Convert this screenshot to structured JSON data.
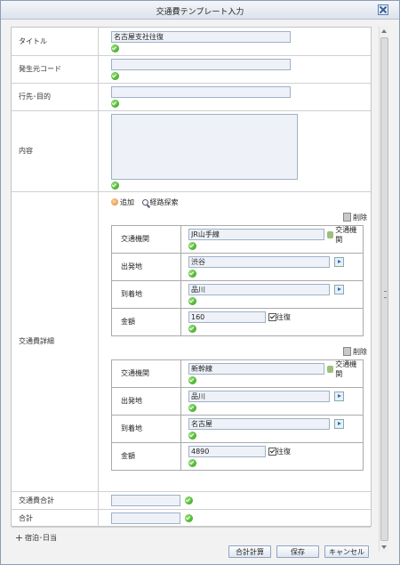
{
  "dialog": {
    "title": "交通費テンプレート入力"
  },
  "form": {
    "title_label": "タイトル",
    "title_value": "名古屋支社往復",
    "source_code_label": "発生元コード",
    "source_code_value": "",
    "destination_label": "行先･目的",
    "destination_value": "",
    "content_label": "内容",
    "content_value": "",
    "details_label": "交通費詳細",
    "add_label": "追加",
    "route_search_label": "経路探索",
    "legs": [
      {
        "delete_label": "削除",
        "transport_label": "交通機関",
        "transport_value": "JR山手線",
        "transport_link": "交通機関",
        "from_label": "出発地",
        "from_value": "渋谷",
        "to_label": "到着地",
        "to_value": "品川",
        "amount_label": "金額",
        "amount_value": "160",
        "round_trip_label": "往復",
        "round_trip_checked": true
      },
      {
        "delete_label": "削除",
        "transport_label": "交通機関",
        "transport_value": "新幹線",
        "transport_link": "交通機関",
        "from_label": "出発地",
        "from_value": "品川",
        "to_label": "到着地",
        "to_value": "名古屋",
        "amount_label": "金額",
        "amount_value": "4890",
        "round_trip_label": "往復",
        "round_trip_checked": true
      }
    ],
    "transport_total_label": "交通費合計",
    "transport_total_value": "",
    "total_label": "合計",
    "total_value": ""
  },
  "expander": {
    "label": "宿泊･日当"
  },
  "buttons": {
    "calculate": "合計計算",
    "save": "保存",
    "cancel": "キャンセル"
  },
  "colors": {
    "accent": "#2d9a1a",
    "field_bg": "#eef2f8",
    "title_bar": "#dde3ec"
  }
}
